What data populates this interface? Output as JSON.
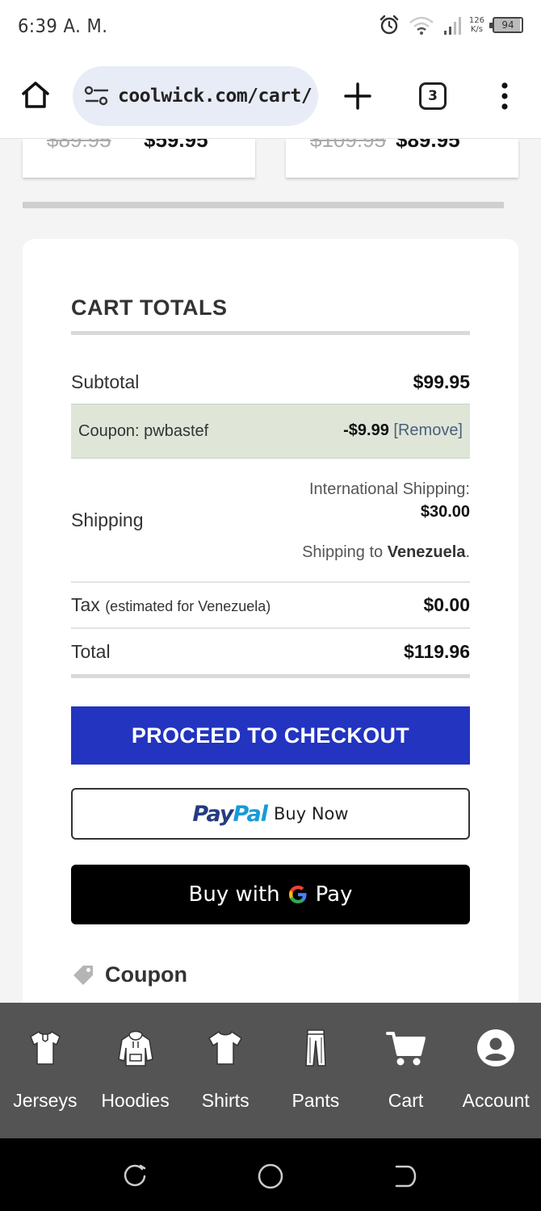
{
  "status_bar": {
    "time": "6:39 A. M.",
    "net_speed_value": "126",
    "net_speed_unit": "K/s",
    "battery": "94",
    "icons": [
      "alarm-icon",
      "wifi-icon",
      "signal-icon",
      "battery-icon"
    ]
  },
  "browser": {
    "url": "coolwick.com/cart/",
    "tab_count": "3",
    "icons": [
      "home-icon",
      "site-settings-icon",
      "new-tab-icon",
      "tabs-icon",
      "menu-icon"
    ]
  },
  "previous_products": [
    {
      "old_price": "$89.95",
      "new_price": "$59.95"
    },
    {
      "old_price": "$109.95",
      "new_price": "$89.95"
    }
  ],
  "cart_totals": {
    "title": "CART TOTALS",
    "subtotal_label": "Subtotal",
    "subtotal_value": "$99.95",
    "coupon_label": "Coupon: pwbastef",
    "coupon_value": "-$9.99",
    "coupon_remove": "[Remove]",
    "shipping_label": "Shipping",
    "shipping_method": "International Shipping:",
    "shipping_value": "$30.00",
    "shipping_to_prefix": "Shipping to ",
    "shipping_country": "Venezuela",
    "shipping_to_suffix": ".",
    "tax_label": "Tax",
    "tax_note": "(estimated for Venezuela)",
    "tax_value": "$0.00",
    "total_label": "Total",
    "total_value": "$119.96"
  },
  "buttons": {
    "checkout": "PROCEED TO CHECKOUT",
    "paypal_pay": "Pay",
    "paypal_pal": "Pal",
    "paypal_text": "Buy Now",
    "gpay_prefix": "Buy with",
    "gpay_suffix": "Pay"
  },
  "coupon_section": {
    "heading": "Coupon"
  },
  "bottom_nav": [
    {
      "label": "Jerseys",
      "icon": "jersey-icon"
    },
    {
      "label": "Hoodies",
      "icon": "hoodie-icon"
    },
    {
      "label": "Shirts",
      "icon": "shirt-icon"
    },
    {
      "label": "Pants",
      "icon": "pants-icon"
    },
    {
      "label": "Cart",
      "icon": "cart-icon"
    },
    {
      "label": "Account",
      "icon": "account-icon"
    }
  ],
  "colors": {
    "checkout_button": "#2234c0",
    "coupon_row_bg": "#dfe6d8",
    "bottom_nav_bg": "#545454",
    "paypal_dark": "#253b80",
    "paypal_light": "#179bd7"
  }
}
